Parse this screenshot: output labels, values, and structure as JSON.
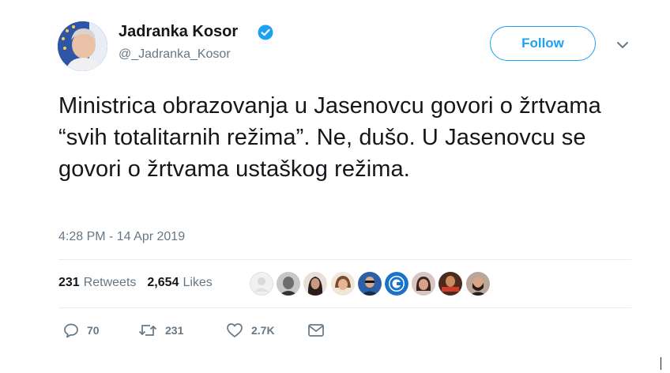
{
  "author": {
    "display_name": "Jadranka Kosor",
    "handle": "@_Jadranka_Kosor",
    "verified": true,
    "avatar_icon": "profile-photo"
  },
  "follow_button": {
    "label": "Follow"
  },
  "menu": {
    "icon": "chevron-down-icon"
  },
  "tweet": {
    "text": "Ministrica obrazovanja u Jasenovcu govori o žrtvama “svih totalitarnih režima”. Ne, dušo. U Jasenovcu se govori o žrtvama ustaškog režima.",
    "timestamp": "4:28 PM - 14 Apr 2019"
  },
  "stats": {
    "retweets_count": "231",
    "retweets_label": "Retweets",
    "likes_count": "2,654",
    "likes_label": "Likes"
  },
  "actions": {
    "reply_count": "70",
    "retweet_count": "231",
    "like_count": "2.7K",
    "reply_icon": "reply-icon",
    "retweet_icon": "retweet-icon",
    "like_icon": "heart-icon",
    "dm_icon": "envelope-icon"
  },
  "colors": {
    "accent": "#1da1f2",
    "text": "#14171a",
    "secondary": "#657786",
    "divider": "#e6ecf0"
  }
}
